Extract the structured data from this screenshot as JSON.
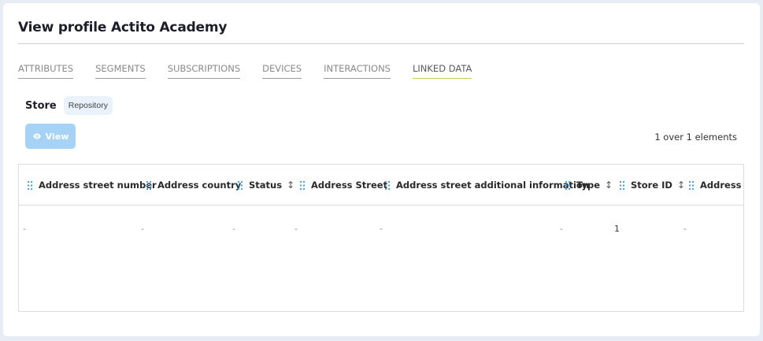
{
  "page": {
    "title": "View profile Actito Academy"
  },
  "tabs": [
    {
      "label": "ATTRIBUTES"
    },
    {
      "label": "SEGMENTS"
    },
    {
      "label": "SUBSCRIPTIONS"
    },
    {
      "label": "DEVICES"
    },
    {
      "label": "INTERACTIONS"
    },
    {
      "label": "LINKED DATA",
      "active": true
    }
  ],
  "store": {
    "label": "Store",
    "badge": "Repository"
  },
  "toolbar": {
    "view_label": "View",
    "count_text": "1 over 1 elements"
  },
  "colors": {
    "accent_button": "#a6d3f5",
    "active_tab_underline": "#c2cf55",
    "grip": "#4aa3df"
  },
  "table": {
    "columns": [
      {
        "label": "Address street number",
        "sortable": false
      },
      {
        "label": "Address country",
        "sortable": false
      },
      {
        "label": "Status",
        "sortable": true,
        "sort_icon": "↕"
      },
      {
        "label": "Address Street",
        "sortable": false
      },
      {
        "label": "Address street additional information",
        "sortable": false
      },
      {
        "label": "Type",
        "sortable": true,
        "sort_icon": "↕"
      },
      {
        "label": "Store ID",
        "sortable": true,
        "sort_icon": "↕"
      },
      {
        "label": "Address po",
        "sortable": false
      }
    ],
    "rows": [
      [
        "-",
        "-",
        "-",
        "-",
        "-",
        "-",
        "1",
        "-"
      ]
    ]
  }
}
